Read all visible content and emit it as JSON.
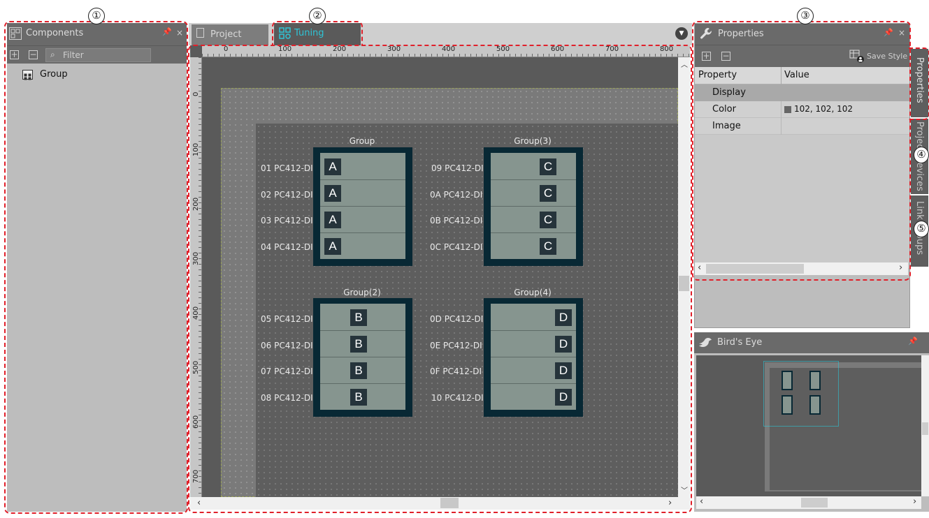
{
  "callouts": [
    "①",
    "②",
    "③",
    "④",
    "⑤"
  ],
  "components": {
    "title": "Components",
    "filter_placeholder": "Filter",
    "tree_item": "Group"
  },
  "tabs": {
    "project": "Project",
    "tuning": "Tuning"
  },
  "ruler": {
    "h_labels": [
      "0",
      "100",
      "200",
      "300",
      "400",
      "500",
      "600",
      "700",
      "800"
    ],
    "v_labels": [
      "0",
      "100",
      "200",
      "300",
      "400",
      "500",
      "600",
      "700"
    ]
  },
  "groups": [
    {
      "title": "Group",
      "letter": "A",
      "devices": [
        "01 PC412-DI",
        "02 PC412-DI",
        "03 PC412-DI",
        "04 PC412-DI"
      ]
    },
    {
      "title": "Group(3)",
      "letter": "C",
      "devices": [
        "09 PC412-DI",
        "0A PC412-DI",
        "0B PC412-DI",
        "0C PC412-DI"
      ]
    },
    {
      "title": "Group(2)",
      "letter": "B",
      "devices": [
        "05 PC412-DI",
        "06 PC412-DI",
        "07 PC412-DI",
        "08 PC412-DI"
      ]
    },
    {
      "title": "Group(4)",
      "letter": "D",
      "devices": [
        "0D PC412-DI",
        "0E PC412-DI",
        "0F PC412-DI",
        "10 PC412-DI"
      ]
    }
  ],
  "properties": {
    "title": "Properties",
    "save_style": "Save Style",
    "col_property": "Property",
    "col_value": "Value",
    "category": "Display",
    "rows": [
      {
        "name": "Color",
        "value": "102, 102, 102",
        "swatch": "#666666"
      },
      {
        "name": "Image",
        "value": ""
      }
    ]
  },
  "side_tabs": [
    "Properties",
    "Project Devices",
    "Link Groups"
  ],
  "birds_eye": {
    "title": "Bird's Eye"
  },
  "colors": {
    "accent": "#2ec4d6",
    "callout": "#e0202a",
    "panel_bg": "#bdbdbd",
    "canvas": "#5f5f5f"
  }
}
